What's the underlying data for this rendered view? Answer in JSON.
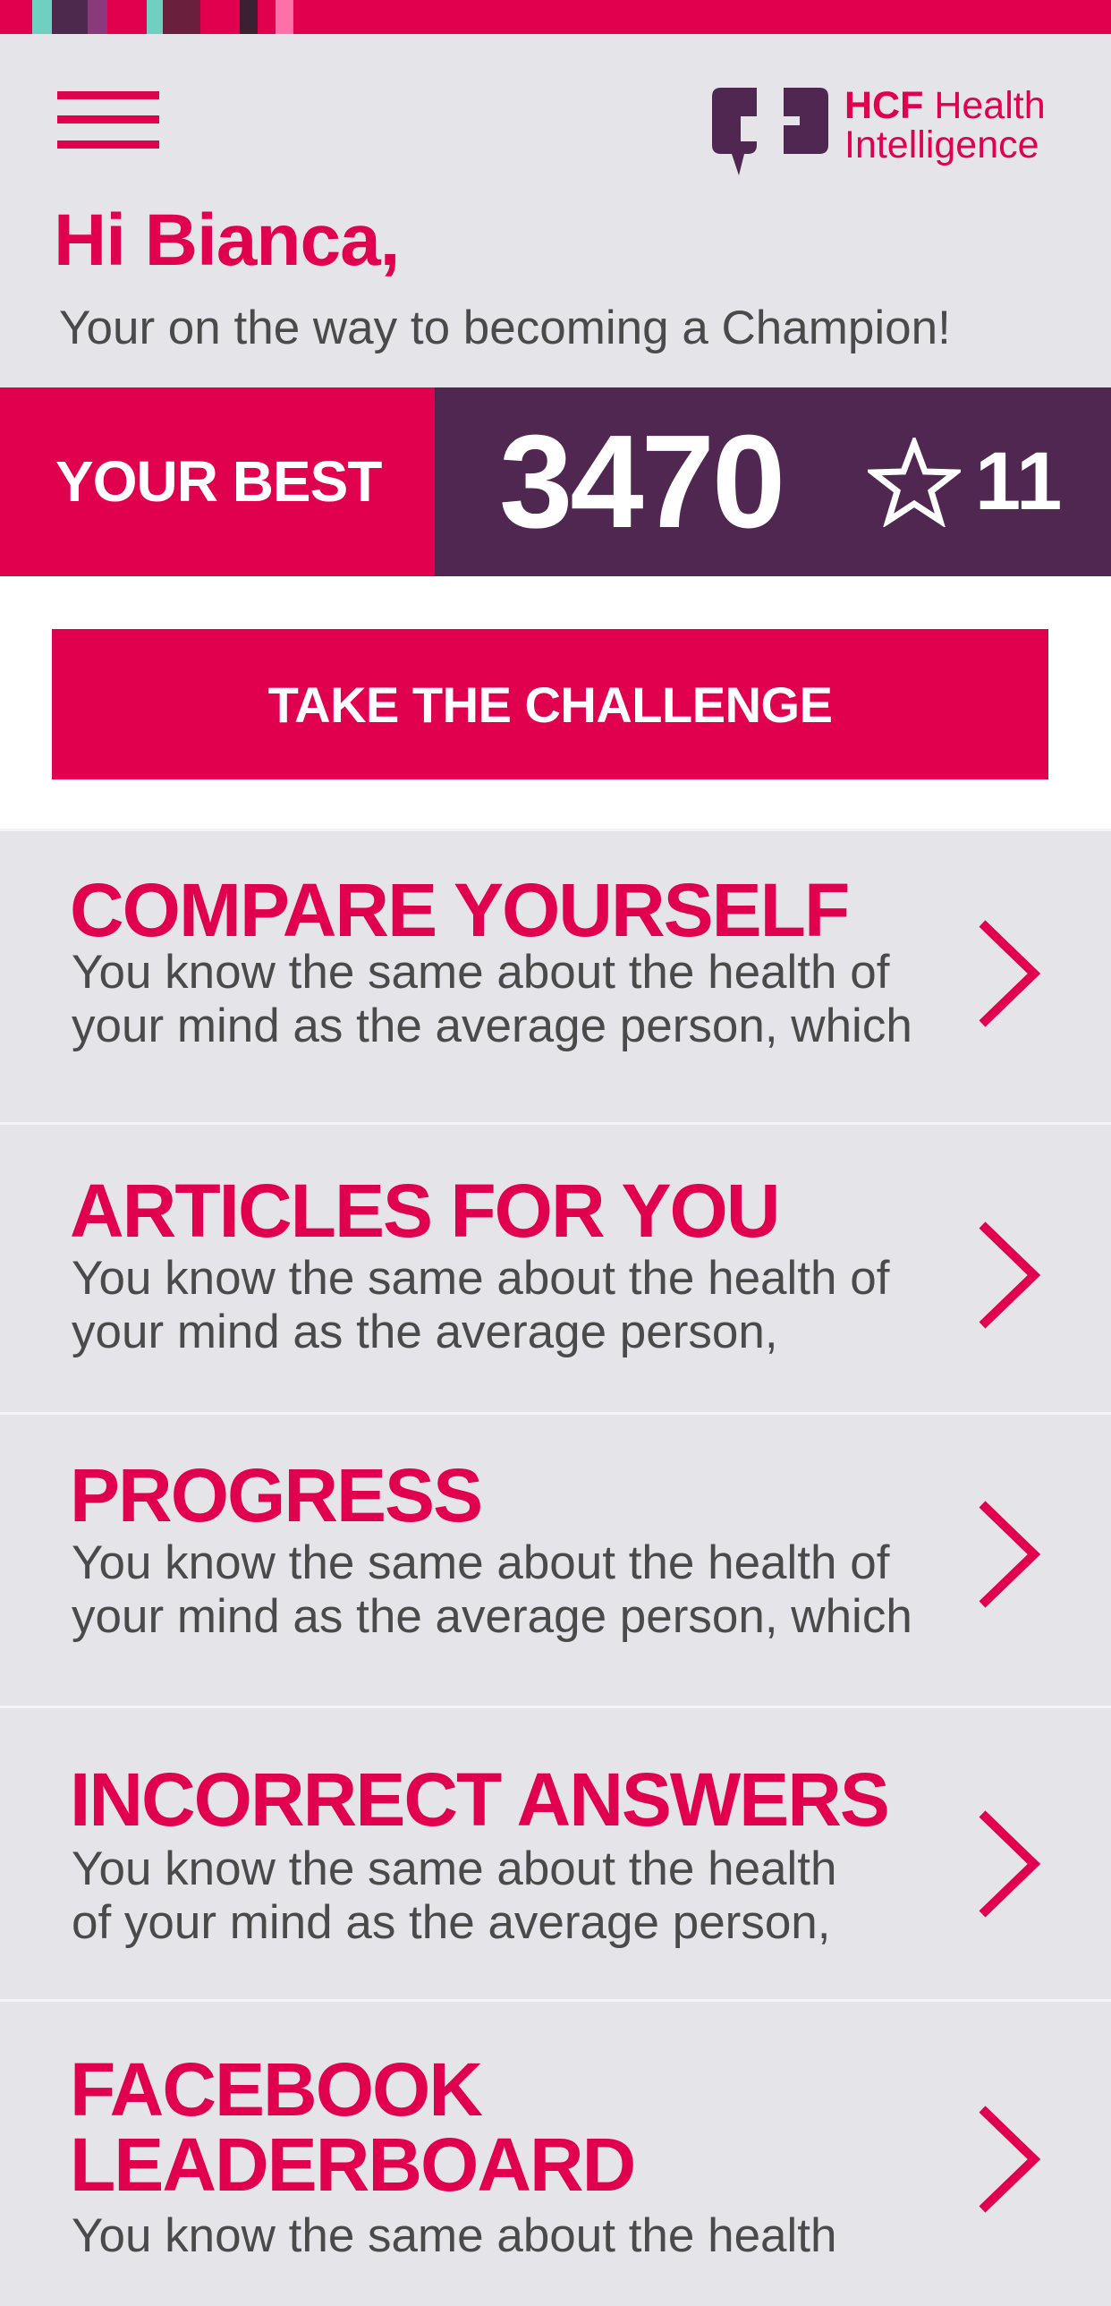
{
  "app": {
    "logo_bold": "HCF",
    "logo_line1": "Health",
    "logo_line2": "Intelligence"
  },
  "colors": {
    "accent": "#e0004d",
    "dark_purple": "#502750",
    "background": "#e5e4e8",
    "stripes": [
      "#e0004d",
      "#6fcfc1",
      "#4d2a4d",
      "#8a3a7a",
      "#6fcfc1",
      "#6a1f3c",
      "#3a2030",
      "#ff6fa8"
    ]
  },
  "header": {
    "menu_icon": "hamburger-icon",
    "greeting": "Hi Bianca,",
    "subtitle": "Your on the way to becoming a Champion!"
  },
  "score": {
    "label": "YOUR BEST",
    "value": "3470",
    "star_icon": "star-outline-icon",
    "stars": "11"
  },
  "cta": {
    "label": "TAKE THE CHALLENGE"
  },
  "cards": [
    {
      "title": "COMPARE YOURSELF",
      "line1": "You know the same about the health of",
      "line2": "your mind as the average person, which"
    },
    {
      "title": "ARTICLES FOR YOU",
      "line1": "You know the same about the health of",
      "line2": "your mind as the average person,"
    },
    {
      "title": "PROGRESS",
      "line1": "You know the same about the health of",
      "line2": "your mind as the average person, which"
    },
    {
      "title": "INCORRECT ANSWERS",
      "line1": "You know the same about the health",
      "line2": "of your mind as the average person,"
    },
    {
      "title_line1": "FACEBOOK",
      "title_line2": "LEADERBOARD",
      "line1": "You know the same about the health"
    }
  ]
}
